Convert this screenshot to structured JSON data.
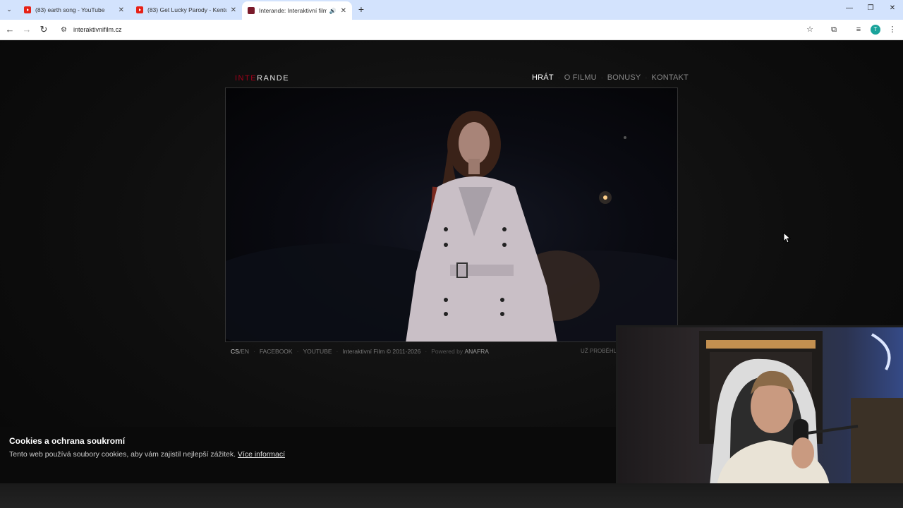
{
  "browser": {
    "tabs": [
      {
        "title": "(83) earth song - YouTube",
        "favicon": "youtube-icon",
        "active": false
      },
      {
        "title": "(83) Get Lucky Parody - Kentuc",
        "favicon": "youtube-icon",
        "active": false
      },
      {
        "title": "Interande: Interaktivní film",
        "favicon": "interande-icon",
        "active": true
      }
    ],
    "url": "interaktivnifilm.cz",
    "profile_initial": "T"
  },
  "site": {
    "logo_red": "INTE",
    "logo_white": "RANDE",
    "nav": [
      "HRÁT",
      "O FILMU",
      "BONUSY",
      "KONTAKT"
    ],
    "footer": {
      "lang_cs": "CS",
      "lang_en": "/EN",
      "facebook": "FACEBOOK",
      "youtube": "YOUTUBE",
      "copyright": "Interaktivní Film © 2011-2026",
      "powered_by": "Powered by",
      "powered_brand": "ANAFRA",
      "already": "UŽ PROBĚHLO"
    }
  },
  "cookie": {
    "title": "Cookies a ochrana soukromí",
    "text": "Tento web používá soubory cookies, aby vám zajistil nejlepší zážitek.",
    "link": "Více informací"
  },
  "colors": {
    "accent_red": "#a3001a",
    "tab_strip": "#d3e3fd",
    "page_bg": "#0b0b0b"
  }
}
